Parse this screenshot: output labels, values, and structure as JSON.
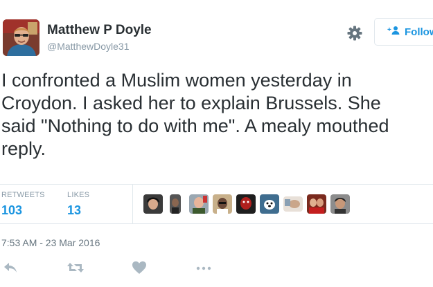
{
  "header": {
    "display_name": "Matthew P Doyle",
    "handle": "@MatthewDoyle31",
    "follow_label": "Follow",
    "settings_icon": "gear-icon",
    "follow_icon": "add-person-icon"
  },
  "tweet": {
    "lines": [
      "I confronted a Muslim women yesterday in",
      "Croydon. I asked her to explain Brussels. She",
      "said \"Nothing to do with me\". A mealy mouthed",
      "reply."
    ]
  },
  "stats": {
    "retweets_label": "RETWEETS",
    "retweets_count": "103",
    "likes_label": "LIKES",
    "likes_count": "13"
  },
  "likers_count_shown": 10,
  "timestamp": "7:53 AM - 23 Mar 2016",
  "actions": [
    "reply-icon",
    "retweet-icon",
    "like-icon",
    "more-icon"
  ],
  "colors": {
    "accent": "#1b95e0",
    "text": "#292f33",
    "muted": "#8899a6",
    "border": "#e1e8ed",
    "icon": "#aab8c2"
  }
}
